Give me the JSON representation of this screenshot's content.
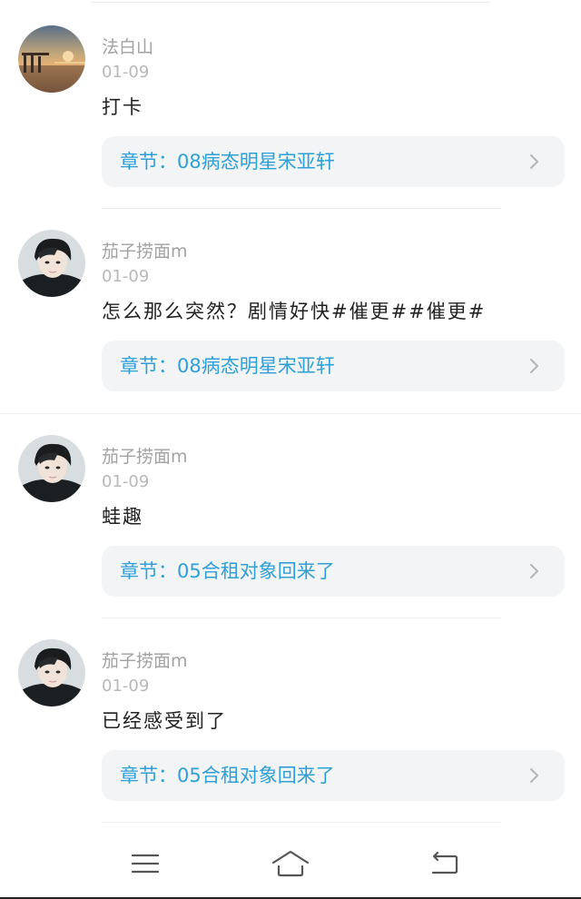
{
  "chapter_prefix": "章节：",
  "comments": [
    {
      "username": "法白山",
      "date": "01-09",
      "content": "打卡",
      "chapter_label": "章节：08病态明星宋亚轩",
      "avatar": "landscape-avatar"
    },
    {
      "username": "茄子捞面m",
      "date": "01-09",
      "content": "怎么那么突然？剧情好快#催更##催更#",
      "chapter_label": "章节：08病态明星宋亚轩",
      "avatar": "person-avatar"
    },
    {
      "username": "茄子捞面m",
      "date": "01-09",
      "content": "蛙趣",
      "chapter_label": "章节：05合租对象回来了",
      "avatar": "person-avatar"
    },
    {
      "username": "茄子捞面m",
      "date": "01-09",
      "content": "已经感受到了",
      "chapter_label": "章节：05合租对象回来了",
      "avatar": "person-avatar"
    }
  ],
  "navbar": {
    "menu_icon": "menu-icon",
    "home_icon": "home-icon",
    "back_icon": "back-icon"
  },
  "colors": {
    "chapter_text": "#2f9fd8",
    "card_bg": "#f3f4f6",
    "username": "#a2a2a2",
    "date": "#b8b8b8",
    "content": "#222222"
  }
}
